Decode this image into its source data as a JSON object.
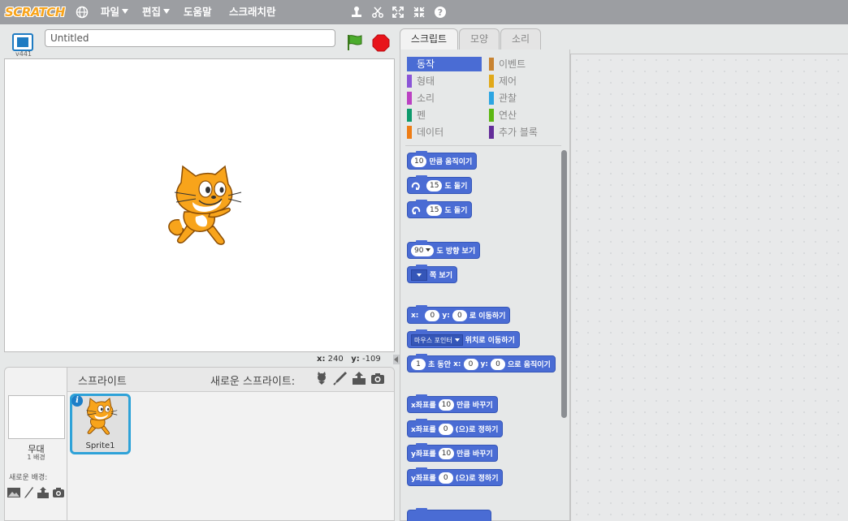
{
  "menubar": {
    "logo": "SCRATCH",
    "file": "파일",
    "edit": "편집",
    "help": "도움말",
    "tips": "스크래치란"
  },
  "stage_header": {
    "version": "v441",
    "project_title": "Untitled"
  },
  "coords": {
    "x_label": "x:",
    "x_value": "240",
    "y_label": "y:",
    "y_value": "-109"
  },
  "sprite_panel": {
    "sprites_label": "스프라이트",
    "new_sprite_label": "새로운 스프라이트:",
    "stage_label": "무대",
    "stage_backdrops": "1 배경",
    "new_backdrop_label": "새로운 배경:",
    "sprite_name": "Sprite1",
    "info_glyph": "i"
  },
  "tabs": [
    "스크립트",
    "모양",
    "소리"
  ],
  "categories": [
    {
      "label": "동작",
      "color": "#4a6cd4"
    },
    {
      "label": "이벤트",
      "color": "#c88330"
    },
    {
      "label": "형태",
      "color": "#8a55d7"
    },
    {
      "label": "제어",
      "color": "#e1a91a"
    },
    {
      "label": "소리",
      "color": "#bb42c3"
    },
    {
      "label": "관찰",
      "color": "#2ca5e2"
    },
    {
      "label": "펜",
      "color": "#0e9a6c"
    },
    {
      "label": "연산",
      "color": "#5cb712"
    },
    {
      "label": "데이터",
      "color": "#ee7d16"
    },
    {
      "label": "추가 블록",
      "color": "#632d99"
    }
  ],
  "blocks": {
    "move": {
      "value": "10",
      "text": "만큼 움직이기"
    },
    "turn_right": {
      "value": "15",
      "text": "도 돌기"
    },
    "turn_left": {
      "value": "15",
      "text": "도 돌기"
    },
    "point_direction": {
      "value": "90",
      "text": "도 방향 보기"
    },
    "point_towards": {
      "text": "쪽 보기"
    },
    "goto_xy": {
      "x_label": "x:",
      "x_value": "0",
      "y_label": "y:",
      "y_value": "0",
      "text": "로 이동하기"
    },
    "goto": {
      "target": "마우스 포인터",
      "text": "위치로 이동하기"
    },
    "glide": {
      "secs": "1",
      "text1": "초 동안",
      "x_label": "x:",
      "x_value": "0",
      "y_label": "y:",
      "y_value": "0",
      "text2": "으로 움직이기"
    },
    "change_x": {
      "prefix": "x좌표를",
      "value": "10",
      "text": "만큼 바꾸기"
    },
    "set_x": {
      "prefix": "x좌표를",
      "value": "0",
      "text": "(으)로 정하기"
    },
    "change_y": {
      "prefix": "y좌표를",
      "value": "10",
      "text": "만큼 바꾸기"
    },
    "set_y": {
      "prefix": "y좌표를",
      "value": "0",
      "text": "(으)로 정하기"
    }
  }
}
